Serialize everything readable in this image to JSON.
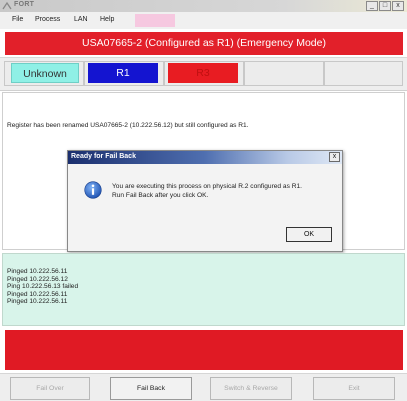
{
  "window": {
    "title": "FORT",
    "minimize_glyph": "_",
    "restore_glyph": "□",
    "close_glyph": "x"
  },
  "menu": {
    "items": [
      "File",
      "Process",
      "LAN",
      "Help"
    ]
  },
  "header": {
    "text": "USA07665-2 (Configured as R1) (Emergency Mode)",
    "color": "#e2202a"
  },
  "status": {
    "unknown_label": "Unknown",
    "r1_label": "R1",
    "r3_label": "R3",
    "unknown_color": "#8ff0e6",
    "r1_color": "#1414d0",
    "r3_color": "#e81c22"
  },
  "message": {
    "text": "Register has been renamed USA07665-2 (10.222.56.12) but still configured as R1."
  },
  "dialog": {
    "title": "Ready for Fail Back",
    "close_glyph": "x",
    "icon": "info-icon",
    "line1": "You are executing this process on physical R.2 configured as R1.",
    "line2": "Run Fail Back after you click OK.",
    "ok_label": "OK"
  },
  "log": {
    "lines": [
      "Pinged 10.222.56.11",
      "Pinged 10.222.56.12",
      "Ping 10.222.56.13 failed",
      "Pinged 10.222.56.11",
      "Pinged 10.222.56.11"
    ]
  },
  "buttons": {
    "fail_over": "Fail Over",
    "fail_back": "Fail Back",
    "switch_reverse": "Switch & Reverse",
    "exit": "Exit"
  }
}
